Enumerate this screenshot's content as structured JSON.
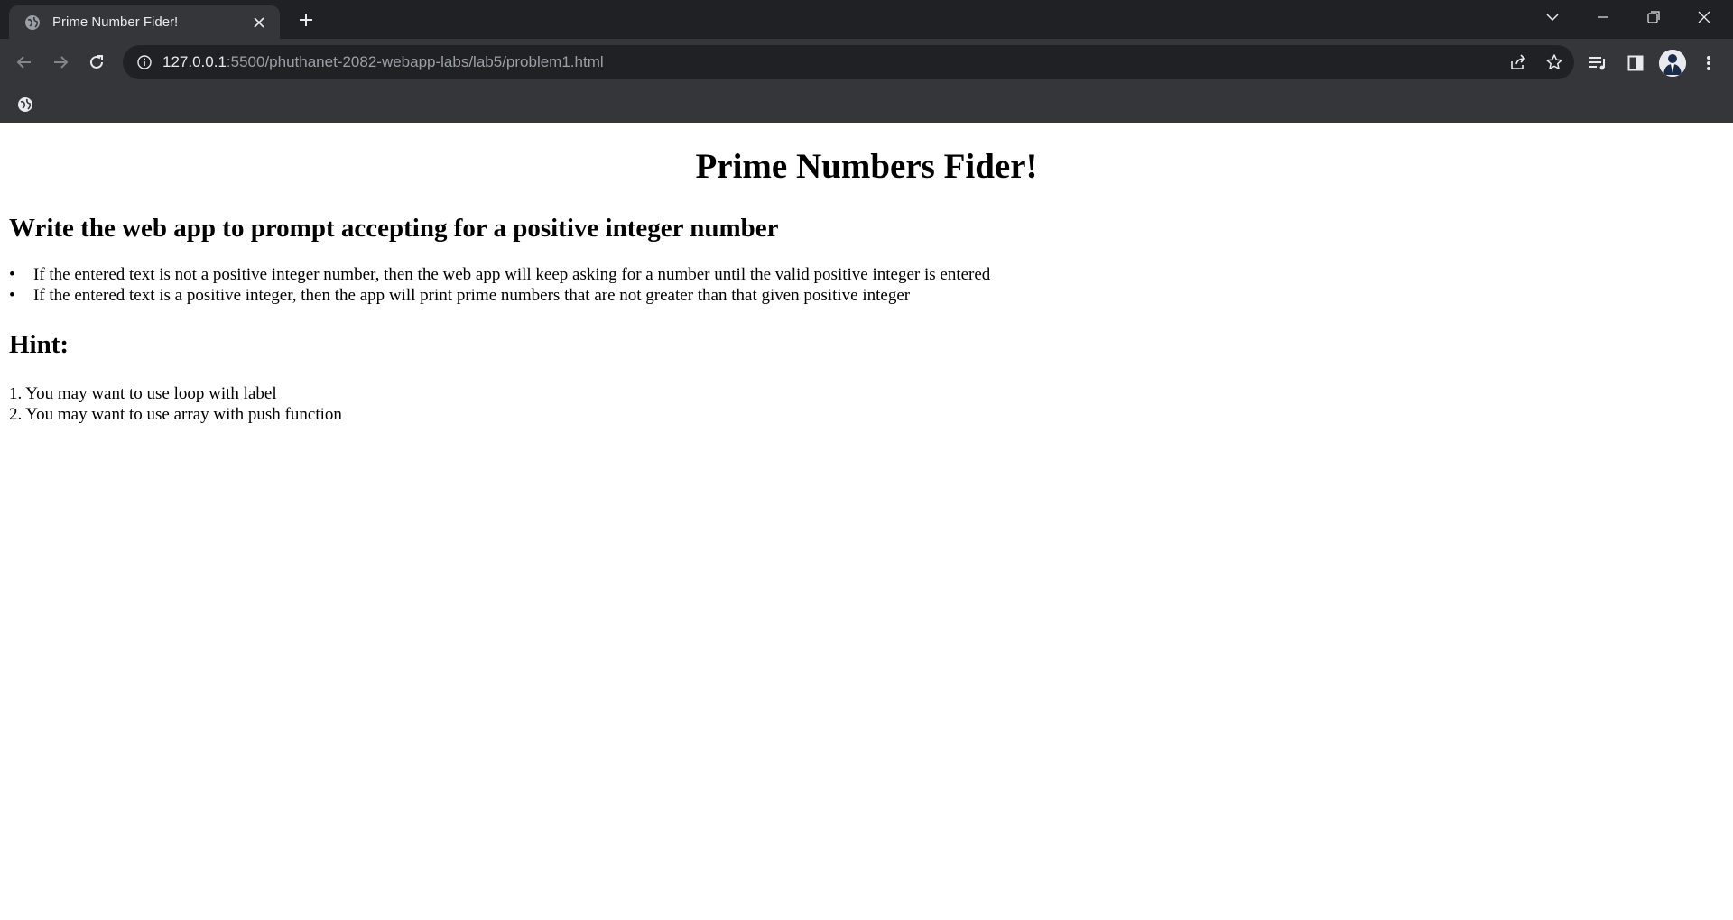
{
  "browser": {
    "tab": {
      "title": "Prime Number Fider!"
    },
    "address_bar": {
      "host": "127.0.0.1",
      "rest": ":5500/phuthanet-2082-webapp-labs/lab5/problem1.html"
    }
  },
  "page": {
    "heading": "Prime Numbers Fider!",
    "task_heading": "Write the web app to prompt accepting for a positive integer number",
    "rules": [
      "If the entered text is not a positive integer number, then the web app will keep asking for a number until the valid positive integer is entered",
      "If the entered text is a positive integer, then the app will print prime numbers that are not greater than that given positive integer"
    ],
    "hint_heading": "Hint:",
    "hints": [
      "1. You may want to use loop with label",
      "2. You may want to use array with push function"
    ]
  },
  "icons": {
    "favicon": "globe-icon",
    "bookmark": "globe-icon"
  },
  "colors": {
    "tabstrip": "#202124",
    "toolbar": "#35363a",
    "omnibox": "#202124",
    "chrome_text": "#e8eaed",
    "url_dim": "#9aa0a6"
  }
}
